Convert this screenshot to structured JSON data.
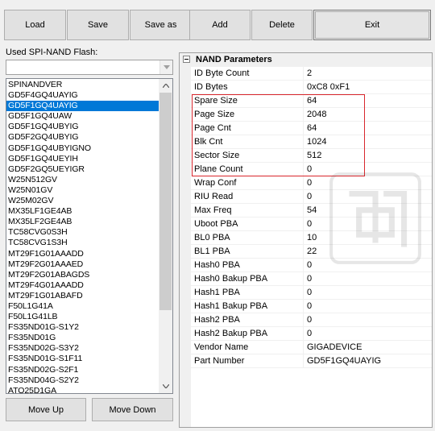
{
  "toolbar": {
    "load": "Load",
    "save": "Save",
    "save_as": "Save as",
    "add": "Add",
    "delete": "Delete",
    "exit": "Exit"
  },
  "flash_list": {
    "label": "Used SPI-NAND Flash:",
    "combo_value": "",
    "selected": "GD5F1GQ4UAYIG",
    "items": [
      "SPINANDVER",
      "GD5F4GQ4UAYIG",
      "GD5F1GQ4UAYIG",
      "GD5F1GQ4UAW",
      "GD5F1GQ4UBYIG",
      "GD5F2GQ4UBYIG",
      "GD5F1GQ4UBYIGNO",
      "GD5F1GQ4UEYIH",
      "GD5F2GQ5UEYIGR",
      "W25N512GV",
      "W25N01GV",
      "W25M02GV",
      "MX35LF1GE4AB",
      "MX35LF2GE4AB",
      "TC58CVG0S3H",
      "TC58CVG1S3H",
      "MT29F1G01AAADD",
      "MT29F2G01AAAED",
      "MT29F2G01ABAGDS",
      "MT29F4G01AAADD",
      "MT29F1G01ABAFD",
      "F50L1G41A",
      "F50L1G41LB",
      "FS35ND01G-S1Y2",
      "FS35ND01G",
      "FS35ND02G-S3Y2",
      "FS35ND01G-S1F11",
      "FS35ND02G-S2F1",
      "FS35ND04G-S2Y2",
      "ATO25D1GA"
    ]
  },
  "bottom_buttons": {
    "move_up": "Move Up",
    "move_down": "Move Down"
  },
  "nand_parameters": {
    "category": "NAND Parameters",
    "rows": [
      {
        "name": "ID Byte Count",
        "value": "2"
      },
      {
        "name": "ID Bytes",
        "value": "0xC8 0xF1"
      },
      {
        "name": "Spare Size",
        "value": "64"
      },
      {
        "name": "Page Size",
        "value": "2048"
      },
      {
        "name": "Page Cnt",
        "value": "64"
      },
      {
        "name": "Blk Cnt",
        "value": "1024"
      },
      {
        "name": "Sector Size",
        "value": "512"
      },
      {
        "name": "Plane Count",
        "value": "0"
      },
      {
        "name": "Wrap Conf",
        "value": "0"
      },
      {
        "name": "RIU Read",
        "value": "0"
      },
      {
        "name": "Max Freq",
        "value": "54"
      },
      {
        "name": "Uboot PBA",
        "value": "0"
      },
      {
        "name": "BL0 PBA",
        "value": "10"
      },
      {
        "name": "BL1 PBA",
        "value": "22"
      },
      {
        "name": "Hash0 PBA",
        "value": "0"
      },
      {
        "name": "Hash0 Bakup PBA",
        "value": "0"
      },
      {
        "name": "Hash1 PBA",
        "value": "0"
      },
      {
        "name": "Hash1 Bakup PBA",
        "value": "0"
      },
      {
        "name": "Hash2 PBA",
        "value": "0"
      },
      {
        "name": "Hash2 Bakup PBA",
        "value": "0"
      },
      {
        "name": "Vendor Name",
        "value": "GIGADEVICE"
      },
      {
        "name": "Part Number",
        "value": "GD5F1GQ4UAYIG"
      }
    ]
  },
  "colors": {
    "selection": "#0078d7",
    "highlight_box": "#d9262c",
    "window_bg": "#f0f0f0",
    "button_bg": "#e1e1e1"
  }
}
